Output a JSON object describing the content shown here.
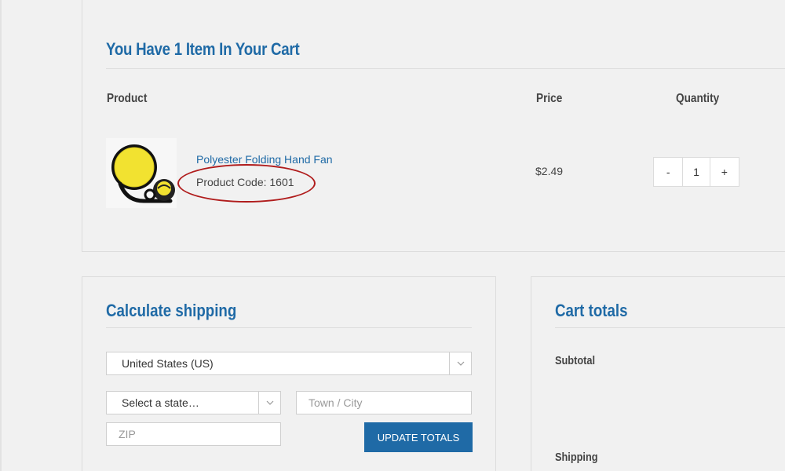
{
  "cart": {
    "title": "You Have 1 Item In Your Cart",
    "columns": {
      "product": "Product",
      "price": "Price",
      "quantity": "Quantity"
    },
    "items": [
      {
        "name": "Polyester Folding Hand Fan",
        "code_label": "Product Code: 1601",
        "price": "$2.49",
        "quantity": "1",
        "decrement_label": "-",
        "increment_label": "+",
        "image_icon": "yellow-folding-fan-image"
      }
    ]
  },
  "shipping": {
    "title": "Calculate shipping",
    "country": "United States (US)",
    "state_placeholder": "Select a state…",
    "city_placeholder": "Town / City",
    "zip_placeholder": "ZIP",
    "update_label": "UPDATE TOTALS"
  },
  "totals": {
    "title": "Cart totals",
    "subtotal_label": "Subtotal",
    "shipping_label": "Shipping"
  },
  "colors": {
    "accent": "#1f6aa6",
    "annotation": "#b01c1c",
    "background": "#f1f1f1"
  }
}
